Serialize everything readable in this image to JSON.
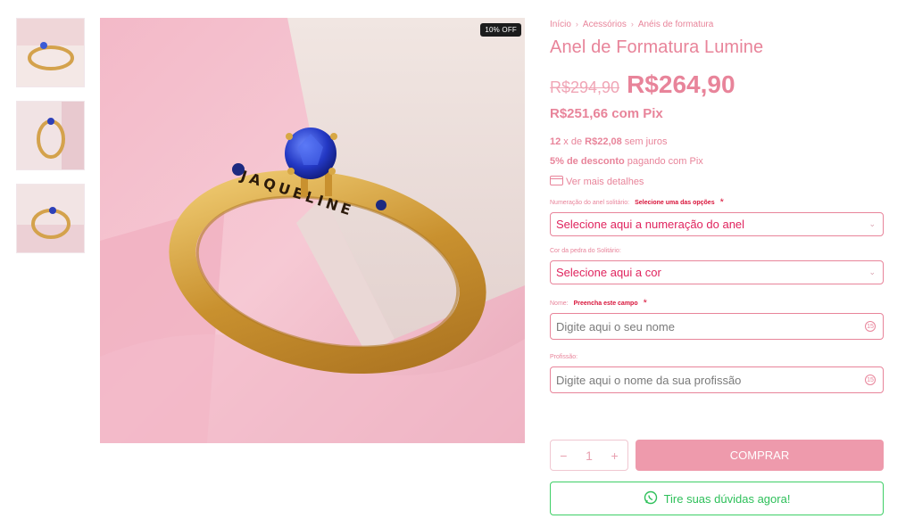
{
  "gallery": {
    "badge": "10% OFF",
    "thumbnails": [
      "ring-thumb-1",
      "ring-thumb-2",
      "ring-thumb-3"
    ]
  },
  "breadcrumb": [
    "Início",
    "Acessórios",
    "Anéis de formatura"
  ],
  "product": {
    "title": "Anel de Formatura Lumine",
    "old_price": "R$294,90",
    "price": "R$264,90",
    "pix_price": "R$251,66 com Pix",
    "installments_count": "12",
    "installments_mid": " x de ",
    "installments_value": "R$22,08",
    "installments_suffix": " sem juros",
    "discount_bold": "5% de desconto",
    "discount_rest": " pagando com Pix",
    "details_link": "Ver mais detalhes"
  },
  "form": {
    "size_label": "Numeração do anel solitário:",
    "size_required": "Selecione uma das opções",
    "size_select": "Selecione aqui a numeração do anel",
    "color_label": "Cor da pedra do Solitário:",
    "color_select": "Selecione aqui a cor",
    "name_label": "Nome:",
    "name_required": "Preencha este campo",
    "name_placeholder": "Digite aqui o seu nome",
    "name_counter": "15",
    "profession_label": "Profissão:",
    "profession_placeholder": "Digite aqui o nome da sua profissão",
    "profession_counter": "15",
    "required_star": "*"
  },
  "purchase": {
    "quantity": "1",
    "minus": "−",
    "plus": "+",
    "buy_label": "COMPRAR",
    "whatsapp_label": "Tire suas dúvidas agora!"
  },
  "colors": {
    "accent": "#e8849a",
    "buy_button": "#ee9aac",
    "whatsapp": "#2ec05a",
    "required": "#d8143a"
  }
}
